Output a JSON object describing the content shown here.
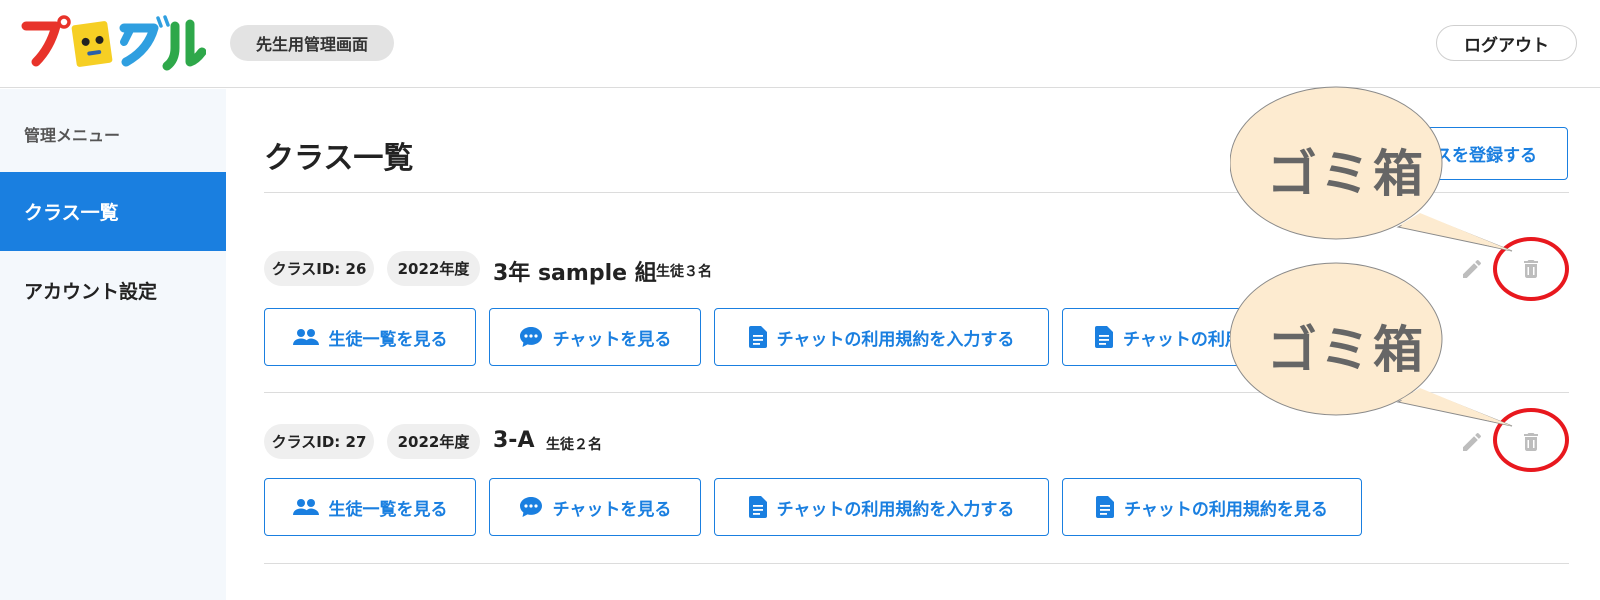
{
  "header": {
    "logo_text": "プログル",
    "role_badge": "先生用管理画面",
    "logout_label": "ログアウト"
  },
  "sidebar": {
    "heading": "管理メニュー",
    "items": [
      {
        "label": "クラス一覧",
        "active": true
      },
      {
        "label": "アカウント設定",
        "active": false
      }
    ]
  },
  "main": {
    "title": "クラス一覧",
    "register_label": "スを登録する",
    "classes": [
      {
        "class_id": "クラスID: 26",
        "year": "2022年度",
        "name": "3年 sample 組",
        "students": "生徒３名",
        "buttons": [
          "生徒一覧を見る",
          "チャットを見る",
          "チャットの利用規約を入力する",
          "チャットの利用"
        ]
      },
      {
        "class_id": "クラスID: 27",
        "year": "2022年度",
        "name": "3-A",
        "students": "生徒２名",
        "buttons": [
          "生徒一覧を見る",
          "チャットを見る",
          "チャットの利用規約を入力する",
          "チャットの利用規約を見る"
        ]
      }
    ]
  },
  "annotations": {
    "callout_1": "ゴミ箱",
    "callout_2": "ゴミ箱"
  },
  "icons": {
    "edit": "pencil-icon",
    "delete": "trash-icon",
    "students": "people-icon",
    "chat": "chat-bubble-icon",
    "terms": "document-icon"
  },
  "colors": {
    "accent": "#1a7fe0",
    "highlight": "#e8181e",
    "callout_fill": "#fdebd0",
    "sidebar_bg": "#f4f8fc"
  }
}
